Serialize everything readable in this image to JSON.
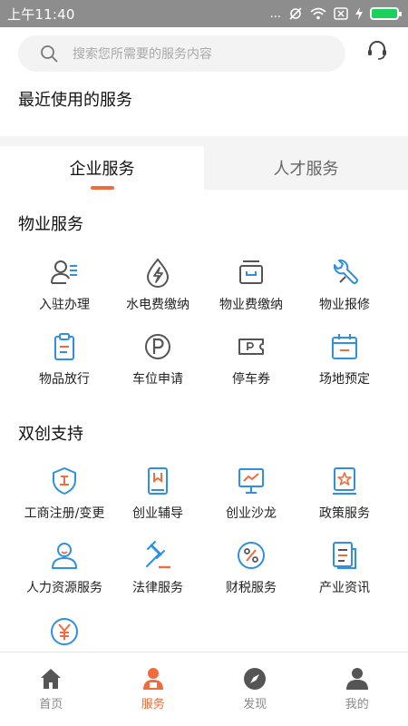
{
  "status_bar": {
    "time": "上午11:40",
    "dots": "...",
    "alarm_glyph": "⏰"
  },
  "search": {
    "placeholder": "搜索您所需要的服务内容"
  },
  "recent": {
    "title": "最近使用的服务"
  },
  "tabs": [
    {
      "label": "企业服务",
      "active": true
    },
    {
      "label": "人才服务",
      "active": false
    }
  ],
  "sections": [
    {
      "title": "物业服务",
      "items": [
        {
          "label": "入驻办理",
          "icon": "person-list-icon"
        },
        {
          "label": "水电费缴纳",
          "icon": "lightning-drop-icon"
        },
        {
          "label": "物业费缴纳",
          "icon": "wallet-icon"
        },
        {
          "label": "物业报修",
          "icon": "wrench-icon"
        },
        {
          "label": "物品放行",
          "icon": "clipboard-icon"
        },
        {
          "label": "车位申请",
          "icon": "parking-icon"
        },
        {
          "label": "停车券",
          "icon": "parking-ticket-icon"
        },
        {
          "label": "场地预定",
          "icon": "calendar-icon"
        }
      ]
    },
    {
      "title": "双创支持",
      "items": [
        {
          "label": "工商注册/变更",
          "icon": "shield-badge-icon"
        },
        {
          "label": "创业辅导",
          "icon": "book-icon"
        },
        {
          "label": "创业沙龙",
          "icon": "presentation-icon"
        },
        {
          "label": "政策服务",
          "icon": "star-document-icon"
        },
        {
          "label": "人力资源服务",
          "icon": "person-icon"
        },
        {
          "label": "法律服务",
          "icon": "gavel-icon"
        },
        {
          "label": "财税服务",
          "icon": "percent-icon"
        },
        {
          "label": "产业资讯",
          "icon": "news-icon"
        },
        {
          "label": "",
          "icon": "yuan-coin-icon"
        }
      ]
    }
  ],
  "bottom_nav": [
    {
      "label": "首页",
      "icon": "home-icon",
      "active": false
    },
    {
      "label": "服务",
      "icon": "service-person-icon",
      "active": true
    },
    {
      "label": "发现",
      "icon": "compass-icon",
      "active": false
    },
    {
      "label": "我的",
      "icon": "user-icon",
      "active": false
    }
  ],
  "colors": {
    "accent": "#f26b3a",
    "icon_blue": "#2f8fe0",
    "status_bar": "#8d8d8d"
  }
}
